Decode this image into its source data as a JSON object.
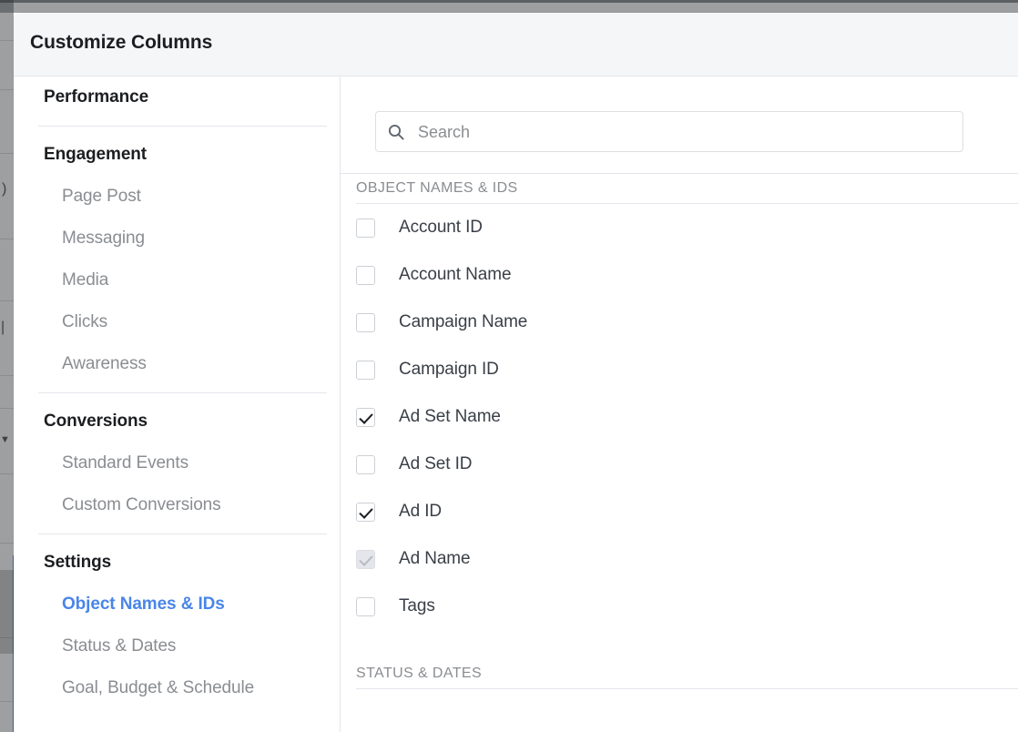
{
  "modal": {
    "title": "Customize Columns"
  },
  "sidebar": {
    "groups": [
      {
        "heading": "Performance",
        "items": []
      },
      {
        "heading": "Engagement",
        "items": [
          {
            "label": "Page Post",
            "active": false
          },
          {
            "label": "Messaging",
            "active": false
          },
          {
            "label": "Media",
            "active": false
          },
          {
            "label": "Clicks",
            "active": false
          },
          {
            "label": "Awareness",
            "active": false
          }
        ]
      },
      {
        "heading": "Conversions",
        "items": [
          {
            "label": "Standard Events",
            "active": false
          },
          {
            "label": "Custom Conversions",
            "active": false
          }
        ]
      },
      {
        "heading": "Settings",
        "items": [
          {
            "label": "Object Names & IDs",
            "active": true
          },
          {
            "label": "Status & Dates",
            "active": false
          },
          {
            "label": "Goal, Budget & Schedule",
            "active": false
          }
        ]
      }
    ]
  },
  "search": {
    "icon": "search-icon",
    "value": "",
    "placeholder": "Search"
  },
  "sections": [
    {
      "title": "OBJECT NAMES & IDS",
      "options": [
        {
          "label": "Account ID",
          "checked": false,
          "disabled": false
        },
        {
          "label": "Account Name",
          "checked": false,
          "disabled": false
        },
        {
          "label": "Campaign Name",
          "checked": false,
          "disabled": false
        },
        {
          "label": "Campaign ID",
          "checked": false,
          "disabled": false
        },
        {
          "label": "Ad Set Name",
          "checked": true,
          "disabled": false
        },
        {
          "label": "Ad Set ID",
          "checked": false,
          "disabled": false
        },
        {
          "label": "Ad ID",
          "checked": true,
          "disabled": false
        },
        {
          "label": "Ad Name",
          "checked": true,
          "disabled": true
        },
        {
          "label": "Tags",
          "checked": false,
          "disabled": false
        }
      ]
    },
    {
      "title": "STATUS & DATES",
      "options": []
    }
  ],
  "colors": {
    "accent": "#4a85e8",
    "header_bg": "#f5f6f7",
    "text_primary": "#1c1e21",
    "text_muted": "#8a8d91",
    "divider": "#e4e6eb",
    "checkbox_disabled_fill": "#e4e6eb"
  }
}
